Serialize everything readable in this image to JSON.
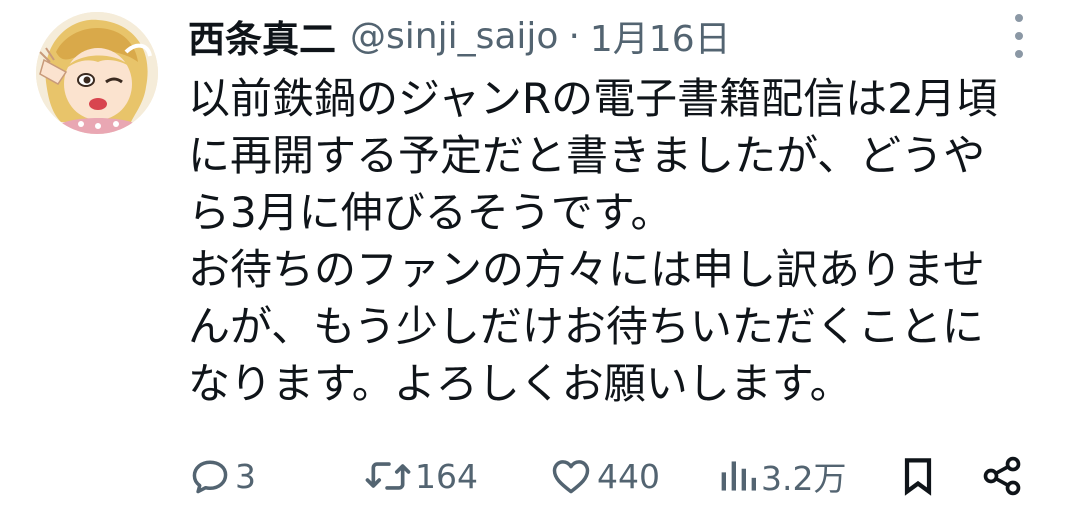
{
  "post": {
    "author_name": "西条真二",
    "handle": "@sinji_saijo",
    "separator": "·",
    "date": "1月16日",
    "text_lines": [
      "以前鉄鍋のジャンRの電子書籍配信は2月頃",
      "に再開する予定だと書きましたが、どうや",
      "ら3月に伸びるそうです。",
      "お待ちのファンの方々には申し訳ありませ",
      "んが、もう少しだけお待ちいただくことに",
      "なります。よろしくお願いします。"
    ]
  },
  "actions": {
    "reply": {
      "icon": "reply-icon",
      "count": "3"
    },
    "repost": {
      "icon": "repost-icon",
      "count": "164"
    },
    "like": {
      "icon": "heart-icon",
      "count": "440"
    },
    "views": {
      "icon": "views-icon",
      "count": "3.2万"
    },
    "bookmark": {
      "icon": "bookmark-icon"
    },
    "share": {
      "icon": "share-icon"
    }
  },
  "colors": {
    "text_primary": "#0f1419",
    "text_secondary": "#536471",
    "background": "#ffffff"
  }
}
